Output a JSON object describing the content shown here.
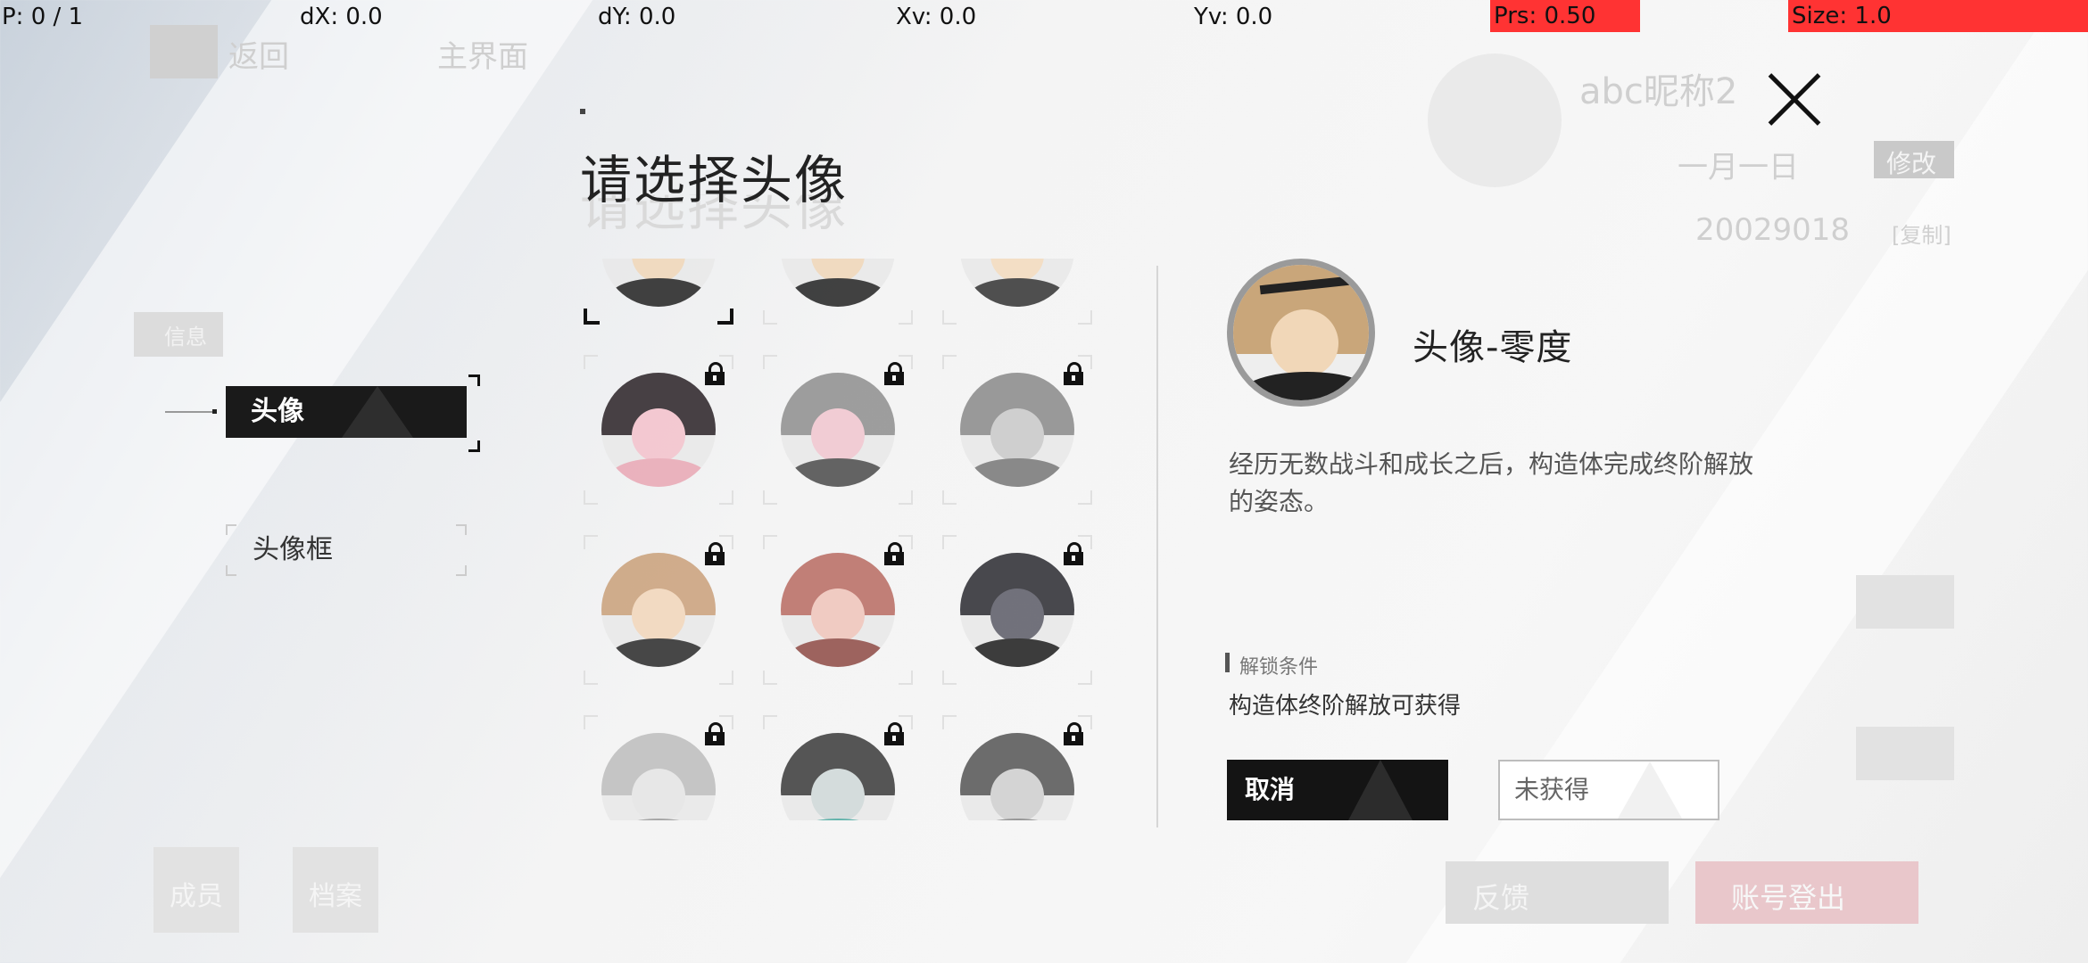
{
  "debug_bar": {
    "p": "P: 0 / 1",
    "dx": "dX: 0.0",
    "dy": "dY: 0.0",
    "xv": "Xv: 0.0",
    "yv": "Yv: 0.0",
    "prs": "Prs: 0.50",
    "size": "Size: 1.0"
  },
  "background": {
    "back_label": "返回",
    "home_label": "主界面",
    "nickname": "abc昵称2",
    "birthday": "一月一日",
    "modify_label": "修改",
    "uid": "20029018",
    "copy_label": "[复制]",
    "members_label": "成员",
    "archive_label": "档案",
    "feedback_label": "反馈",
    "logout_label": "账号登出",
    "menu_label": "信息"
  },
  "dialog": {
    "title": "请选择头像",
    "menu": {
      "active": "头像",
      "item": "头像框"
    },
    "detail": {
      "name": "头像-零度",
      "description": "经历无数战斗和成长之后，构造体完成终阶解放的姿态。",
      "unlock_title": "解锁条件",
      "unlock_condition": "构造体终阶解放可获得",
      "cancel_label": "取消",
      "status_label": "未获得"
    }
  },
  "colors": {
    "accent_dark": "#141414",
    "overlay_red": "#ff3333"
  },
  "avatars": [
    {
      "hair": "#c9a67a",
      "face": "#f1d7b8",
      "body": "#222",
      "locked": true,
      "selected": true
    },
    {
      "hair": "#bfa287",
      "face": "#f0d6b8",
      "body": "#222",
      "locked": true,
      "selected": false
    },
    {
      "hair": "#d7b37d",
      "face": "#f3dbbd",
      "body": "#333",
      "locked": true,
      "selected": false
    },
    {
      "hair": "#2a2226",
      "face": "#f4c2cc",
      "body": "#e9a7b4",
      "locked": true,
      "selected": false
    },
    {
      "hair": "#8f8f8f",
      "face": "#f1c6cf",
      "body": "#4a4a4a",
      "locked": true,
      "selected": false
    },
    {
      "hair": "#8a8a8a",
      "face": "#c9c9c9",
      "body": "#777",
      "locked": true,
      "selected": false
    },
    {
      "hair": "#caa07a",
      "face": "#f2d6ba",
      "body": "#2a2a2a",
      "locked": true,
      "selected": false
    },
    {
      "hair": "#b96b62",
      "face": "#f0c4ba",
      "body": "#8e4a44",
      "locked": true,
      "selected": false
    },
    {
      "hair": "#2a2a30",
      "face": "#5b5b66",
      "body": "#1c1c1c",
      "locked": true,
      "selected": false
    },
    {
      "hair": "#bdbdbd",
      "face": "#e5e5e5",
      "body": "#999",
      "locked": true,
      "selected": false
    },
    {
      "hair": "#3a3a3a",
      "face": "#cfd8d8",
      "body": "#4aa9a0",
      "locked": true,
      "selected": false
    },
    {
      "hair": "#555",
      "face": "#cfcfcf",
      "body": "#888",
      "locked": true,
      "selected": false
    }
  ]
}
